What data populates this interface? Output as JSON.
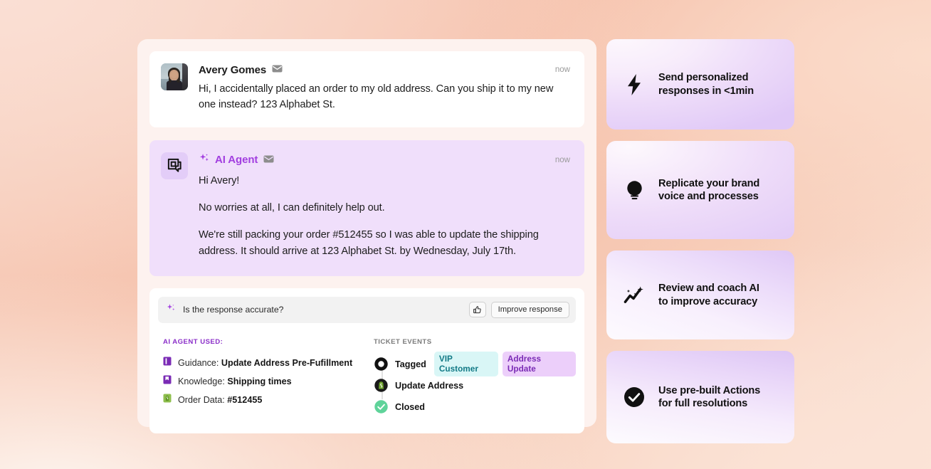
{
  "conversation": {
    "user_message": {
      "sender": "Avery Gomes",
      "channel_icon": "envelope-icon",
      "timestamp": "now",
      "text": "Hi, I accidentally placed an order to my old address. Can you ship it to my new one instead? 123 Alphabet St."
    },
    "agent_message": {
      "sender": "AI Agent",
      "channel_icon": "envelope-icon",
      "timestamp": "now",
      "paragraphs": [
        "Hi Avery!",
        "No worries at all, I can definitely help out.",
        "We're still packing your order #512455 so I was able to update the shipping address. It should arrive at 123 Alphabet St. by Wednesday, July 17th."
      ]
    }
  },
  "feedback": {
    "question": "Is the response accurate?",
    "thumbs_up_icon": "thumbs-up-icon",
    "improve_label": "Improve response"
  },
  "agent_used": {
    "title": "AI AGENT USED:",
    "items": [
      {
        "icon": "guidance-book-icon",
        "label": "Guidance:",
        "value": "Update Address Pre-Fufillment"
      },
      {
        "icon": "knowledge-bookmark-icon",
        "label": "Knowledge:",
        "value": "Shipping times"
      },
      {
        "icon": "shopify-bag-icon",
        "label": "Order Data:",
        "value": "#512455"
      }
    ]
  },
  "ticket_events": {
    "title": "TICKET EVENTS",
    "events": [
      {
        "icon": "ring-icon",
        "label": "Tagged",
        "tags": [
          {
            "text": "VIP Customer",
            "color": "#127a86",
            "bg": "#d9f6f6"
          },
          {
            "text": "Address Update",
            "color": "#7a2bb5",
            "bg": "#eccffa"
          }
        ]
      },
      {
        "icon": "shopify-circle-icon",
        "label": "Update Address",
        "tags": []
      },
      {
        "icon": "check-circle-icon",
        "label": "Closed",
        "tags": []
      }
    ]
  },
  "feature_cards": [
    {
      "icon": "lightning-bolt-icon",
      "line1": "Send personalized",
      "line2": "responses in <1min"
    },
    {
      "icon": "lightbulb-icon",
      "line1": "Replicate your brand",
      "line2": "voice and processes"
    },
    {
      "icon": "chart-sparkle-icon",
      "line1": "Review and coach AI",
      "line2": "to improve accuracy"
    },
    {
      "icon": "check-circle-filled-icon",
      "line1": "Use pre-built Actions",
      "line2": "for full resolutions"
    }
  ],
  "theme": {
    "accent_purple": "#a23ee0",
    "agent_bubble": "#f0dffb",
    "panel_bg": "#fdf2ef"
  }
}
